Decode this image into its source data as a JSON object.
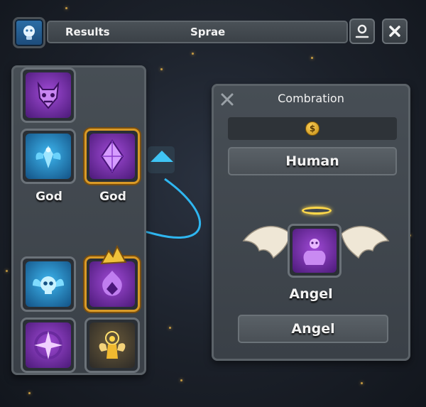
{
  "topbar": {
    "results_label": "Results",
    "tab_name": "Sprae",
    "icons": [
      "lightbulb-icon",
      "user-icon",
      "close-icon"
    ]
  },
  "left_panel": {
    "tiles": [
      {
        "name": "demon-mask",
        "color": "purple",
        "label": ""
      },
      {
        "name": "blue-winged-spirit",
        "color": "blue",
        "label": "God"
      },
      {
        "name": "purple-crystal",
        "color": "purple",
        "label": "God",
        "selected": true
      },
      {
        "name": "winged-skull",
        "color": "blue",
        "label": ""
      },
      {
        "name": "purple-flame",
        "color": "purple",
        "label": "",
        "selected": true
      },
      {
        "name": "purple-compass",
        "color": "purple",
        "label": ""
      },
      {
        "name": "golden-angel",
        "color": "gold",
        "label": ""
      }
    ]
  },
  "combination_panel": {
    "title": "Combration",
    "coin_symbol": "$",
    "input_element": "Human",
    "result_icon": "angel-icon",
    "result_name": "Angel",
    "output_label": "Angel"
  },
  "colors": {
    "panel": "#434a51",
    "gold_border": "#d99a27",
    "link_line": "#2fb6f0",
    "halo": "#ffd84a"
  }
}
